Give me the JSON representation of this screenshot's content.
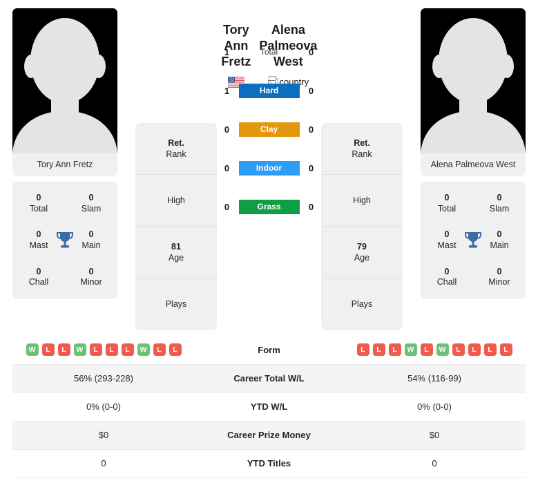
{
  "players": {
    "left": {
      "first_line": "Tory Ann",
      "second_line": "Fretz",
      "full_name": "Tory Ann Fretz",
      "country_icon": "us-flag-icon",
      "photo_caption": "Tory Ann Fretz",
      "titles": [
        {
          "num": "0",
          "label": "Total"
        },
        {
          "num": "0",
          "label": "Slam"
        },
        {
          "num": "0",
          "label": "Mast"
        },
        {
          "num": "0",
          "label": "Main"
        },
        {
          "num": "0",
          "label": "Chall"
        },
        {
          "num": "0",
          "label": "Minor"
        }
      ],
      "rank_value": "Ret.",
      "rank_caption": "Rank",
      "high_value": "",
      "high_caption": "High",
      "age_value": "81",
      "age_caption": "Age",
      "plays_value": "",
      "plays_caption": "Plays"
    },
    "right": {
      "first_line": "Alena",
      "second_line": "Palmeova West",
      "full_name": "Alena Palmeova West",
      "country_icon": "broken-image-icon",
      "country_alt": "country",
      "photo_caption": "Alena Palmeova West",
      "titles": [
        {
          "num": "0",
          "label": "Total"
        },
        {
          "num": "0",
          "label": "Slam"
        },
        {
          "num": "0",
          "label": "Mast"
        },
        {
          "num": "0",
          "label": "Main"
        },
        {
          "num": "0",
          "label": "Chall"
        },
        {
          "num": "0",
          "label": "Minor"
        }
      ],
      "rank_value": "Ret.",
      "rank_caption": "Rank",
      "high_value": "",
      "high_caption": "High",
      "age_value": "79",
      "age_caption": "Age",
      "plays_value": "",
      "plays_caption": "Plays"
    }
  },
  "head_to_head": [
    {
      "label": "Total",
      "left": "1",
      "right": "0",
      "color": "",
      "style": "plain"
    },
    {
      "label": "Hard",
      "left": "1",
      "right": "0",
      "color": "#0d6ebd",
      "style": "pill"
    },
    {
      "label": "Clay",
      "left": "0",
      "right": "0",
      "color": "#e2970d",
      "style": "pill"
    },
    {
      "label": "Indoor",
      "left": "0",
      "right": "0",
      "color": "#2f9cf4",
      "style": "pill"
    },
    {
      "label": "Grass",
      "left": "0",
      "right": "0",
      "color": "#0f9e45",
      "style": "pill"
    }
  ],
  "stats_rows": [
    {
      "label": "Form",
      "type": "form",
      "left_form": [
        "W",
        "L",
        "L",
        "W",
        "L",
        "L",
        "L",
        "W",
        "L",
        "L"
      ],
      "right_form": [
        "L",
        "L",
        "L",
        "W",
        "L",
        "W",
        "L",
        "L",
        "L",
        "L"
      ]
    },
    {
      "label": "Career Total W/L",
      "type": "text",
      "left": "56% (293-228)",
      "right": "54% (116-99)"
    },
    {
      "label": "YTD W/L",
      "type": "text",
      "left": "0% (0-0)",
      "right": "0% (0-0)"
    },
    {
      "label": "Career Prize Money",
      "type": "text",
      "left": "$0",
      "right": "$0"
    },
    {
      "label": "YTD Titles",
      "type": "text",
      "left": "0",
      "right": "0"
    }
  ],
  "colors": {
    "hard": "#0d6ebd",
    "clay": "#e2970d",
    "indoor": "#2f9cf4",
    "grass": "#0f9e45",
    "win_badge": "#6ec077",
    "loss_badge": "#ef5b4c",
    "trophy": "#3a6ca8",
    "card_bg": "#f0f0f0"
  }
}
